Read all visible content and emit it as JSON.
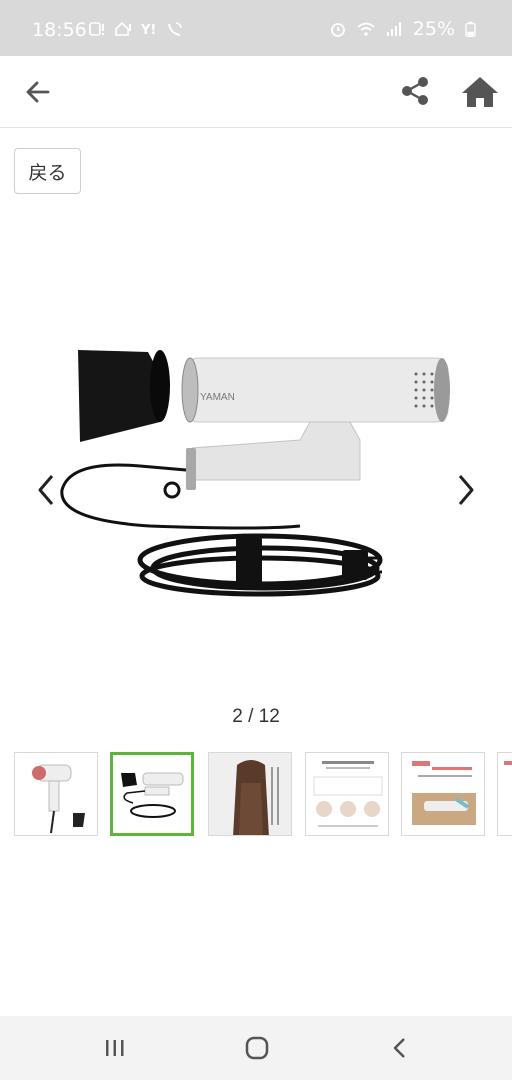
{
  "status_bar": {
    "time": "18:56",
    "battery": "25%",
    "icons_left": [
      "sim-alert-icon",
      "home-alert-icon",
      "yahoo-icon",
      "wifi-calling-icon"
    ],
    "icons_right": [
      "alarm-icon",
      "wifi-icon",
      "signal-icon",
      "battery-icon"
    ]
  },
  "app_bar": {
    "back_icon": "arrow-left-icon",
    "share_icon": "share-icon",
    "home_icon": "home-icon"
  },
  "gallery": {
    "back_button_label": "戻る",
    "counter": "2 / 12",
    "brand_on_product": "YAMAN",
    "thumbnails": [
      {
        "name": "thumb-dryer-full"
      },
      {
        "name": "thumb-dryer-parts",
        "selected": true
      },
      {
        "name": "thumb-hair-model"
      },
      {
        "name": "thumb-feature-chart"
      },
      {
        "name": "thumb-sensor-info"
      },
      {
        "name": "thumb-partial"
      }
    ],
    "colors": {
      "active_border": "#5fb53b",
      "status_bar_bg": "#d9d9d9"
    }
  },
  "nav_bar": {
    "recent_icon": "recent-apps-icon",
    "home_icon": "home-circle-icon",
    "back_icon": "chevron-left-icon"
  }
}
